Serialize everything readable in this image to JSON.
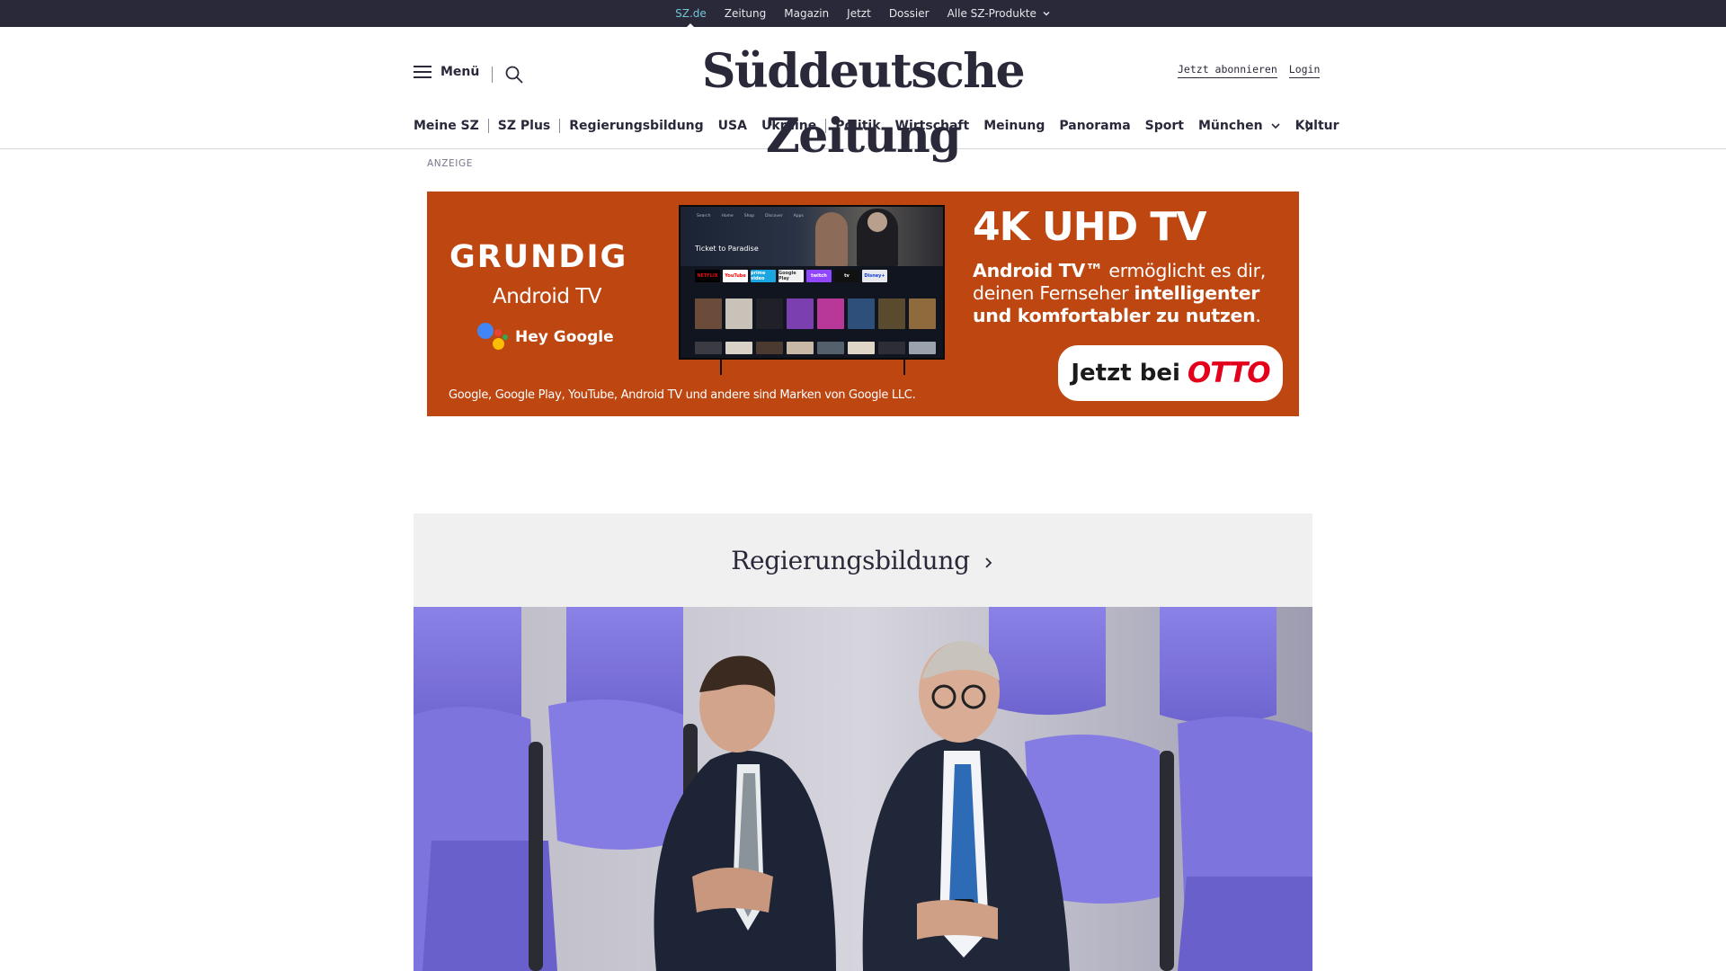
{
  "topbar": {
    "links": [
      "SZ.de",
      "Zeitung",
      "Magazin",
      "Jetzt",
      "Dossier"
    ],
    "products_label": "Alle SZ-Produkte"
  },
  "header": {
    "menu_label": "Menü",
    "logo_text": "Süddeutsche Zeitung",
    "subscribe_label": "Jetzt abonnieren",
    "login_label": "Login"
  },
  "nav": {
    "items": [
      "Meine SZ",
      "SZ Plus",
      "Regierungsbildung",
      "USA",
      "Ukraine",
      "Politik",
      "Wirtschaft",
      "Meinung",
      "Panorama",
      "Sport",
      "München",
      "Kultur"
    ]
  },
  "ad": {
    "label": "ANZEIGE",
    "brand": "GRUNDIG",
    "platform": "Android TV",
    "assistant": "Hey Google",
    "headline": "4K UHD TV",
    "copy_part1": "Android TV™",
    "copy_part2": " ermöglicht es dir, deinen Fernseher ",
    "copy_part3": "intelligenter und komfortabler zu nutzen",
    "copy_part4": ".",
    "cta_prefix": "Jetzt bei",
    "cta_brand": "OTTO",
    "legal": "Google, Google Play, YouTube, Android TV und andere sind Marken von Google LLC.",
    "tv_screen": {
      "menu": [
        "Search",
        "Home",
        "Shop",
        "Discover",
        "Apps"
      ],
      "title": "Ticket to Paradise",
      "apps": [
        "NETFLIX",
        "YouTube",
        "prime video",
        "Google Play",
        "twitch",
        "tv",
        "Disney+"
      ]
    }
  },
  "teaser": {
    "section_title": "Regierungsbildung"
  },
  "colors": {
    "topbar_bg": "#29293a",
    "active_link": "#71c5d4",
    "ad_bg": "#bd4611",
    "otto_red": "#e3001b",
    "teaser_bg": "#f0f0f0",
    "seat_purple": "#7b72d8"
  }
}
